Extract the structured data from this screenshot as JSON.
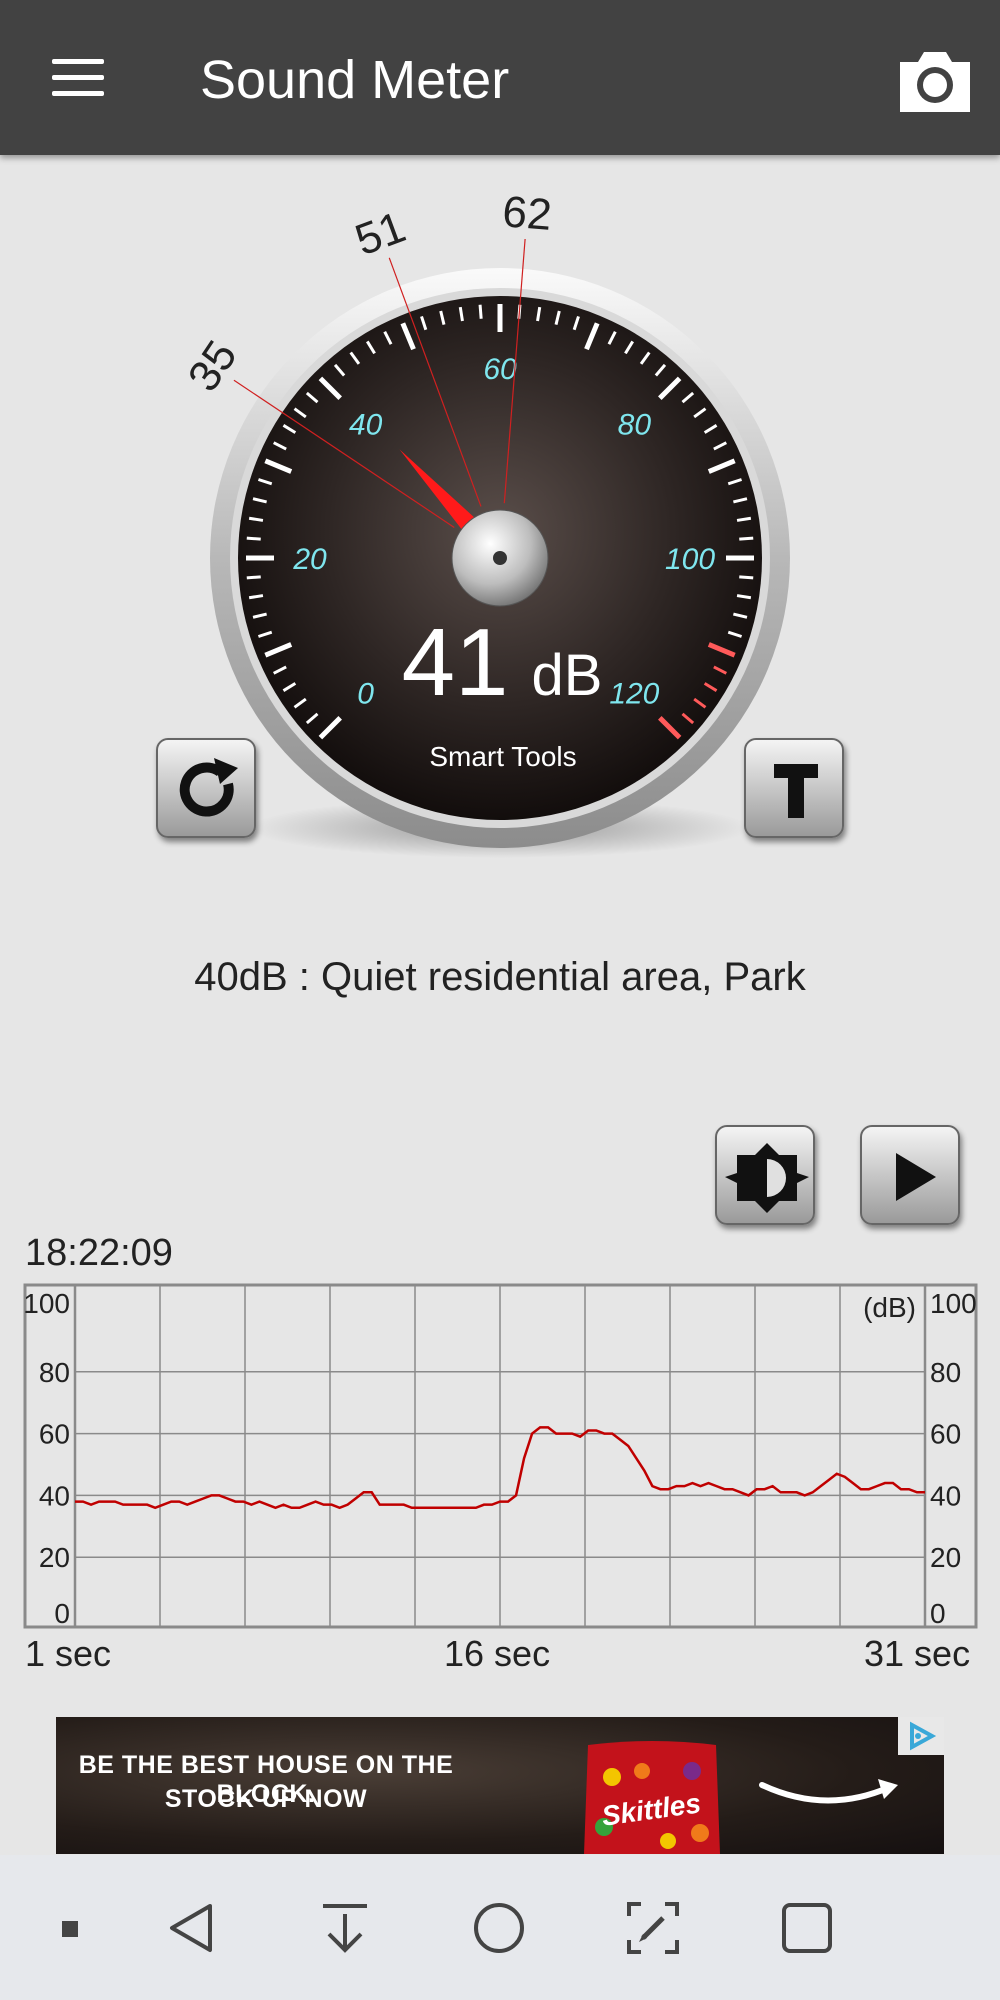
{
  "appbar": {
    "title": "Sound Meter"
  },
  "gauge": {
    "reading": "41",
    "unit": "dB",
    "brand": "Smart Tools",
    "value": 41,
    "scale_labels": [
      "0",
      "20",
      "40",
      "60",
      "80",
      "100",
      "120"
    ],
    "markers": [
      "35",
      "51",
      "62"
    ],
    "marker_values": [
      35,
      51,
      62
    ]
  },
  "reference": {
    "text": "40dB : Quiet residential area, Park"
  },
  "graph": {
    "time": "18:22:09",
    "unit": "(dB)",
    "y_labels": [
      "100",
      "80",
      "60",
      "40",
      "20",
      "0"
    ],
    "x_start": "1 sec",
    "x_mid": "16 sec",
    "x_end": "31 sec"
  },
  "chart_data": {
    "type": "line",
    "series": [
      {
        "values": [
          38,
          38,
          37,
          38,
          38,
          38,
          37,
          37,
          37,
          37,
          36,
          37,
          38,
          38,
          37,
          38,
          39,
          40,
          40,
          39,
          38,
          38,
          37,
          38,
          37,
          36,
          37,
          36,
          36,
          37,
          38,
          37,
          37,
          36,
          37,
          39,
          41,
          41,
          37,
          37,
          37,
          37,
          36,
          36,
          36,
          36,
          36,
          36,
          36,
          36,
          36,
          37,
          37,
          38,
          38,
          40,
          52,
          60,
          62,
          62,
          60,
          60,
          60,
          59,
          61,
          61,
          60,
          60,
          58,
          56,
          52,
          48,
          43,
          42,
          42,
          43,
          43,
          44,
          43,
          44,
          43,
          42,
          42,
          41,
          40,
          42,
          42,
          43,
          41,
          41,
          41,
          40,
          41,
          43,
          45,
          47,
          46,
          44,
          42,
          42,
          43,
          44,
          44,
          42,
          42,
          41,
          41
        ]
      }
    ],
    "ylim": [
      0,
      100
    ],
    "grid": true
  },
  "ad": {
    "line1": "BE THE BEST HOUSE ON THE BLOCK.",
    "line2": "STOCK UP NOW",
    "product": "Skittles"
  },
  "colors": {
    "appbar": "#424242",
    "trace": "#c00000",
    "scale_text": "#7fe6ee",
    "needle": "#ff1a1a"
  },
  "icons": [
    "menu-icon",
    "camera-icon",
    "refresh-icon",
    "text-t-icon",
    "brightness-icon",
    "play-icon",
    "adchoices-icon",
    "square-dot-icon",
    "back-icon",
    "download-icon",
    "home-icon",
    "screenshot-edit-icon",
    "recents-icon"
  ]
}
